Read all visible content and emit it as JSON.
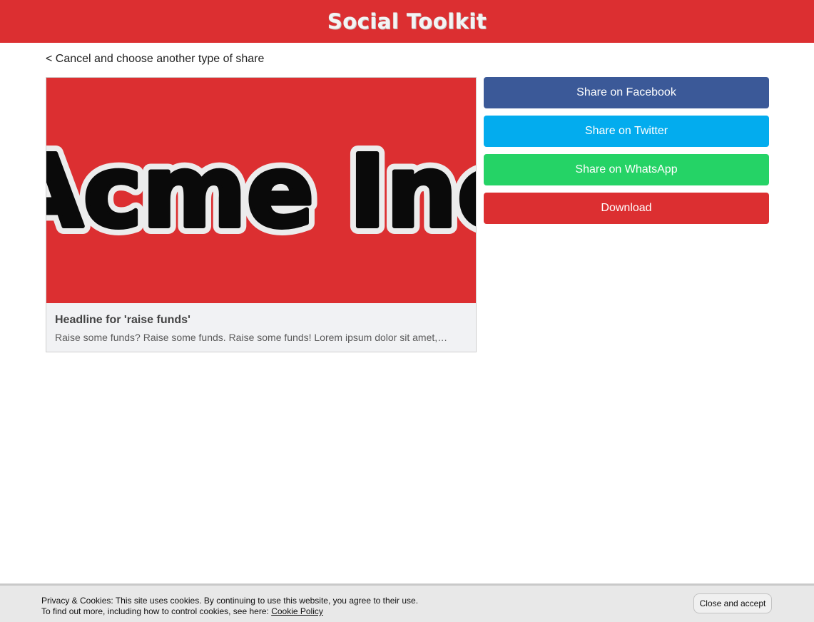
{
  "header": {
    "title": "Social Toolkit",
    "color": "#dc2f31"
  },
  "nav": {
    "back_label": "< Cancel and choose another type of share"
  },
  "preview": {
    "image_logo_text": "Acme Inc",
    "headline": "Headline for 'raise funds'",
    "description": "Raise some funds? Raise some funds. Raise some funds! Lorem ipsum dolor sit amet, consectetur adipiscing elit."
  },
  "share_buttons": [
    {
      "label": "Share on Facebook",
      "color": "#3b5998"
    },
    {
      "label": "Share on Twitter",
      "color": "#03acee"
    },
    {
      "label": "Share on WhatsApp",
      "color": "#25d366"
    },
    {
      "label": "Download",
      "color": "#dc2f31"
    }
  ],
  "cookie": {
    "line1": "Privacy & Cookies: This site uses cookies. By continuing to use this website, you agree to their use.",
    "line2_prefix": "To find out more, including how to control cookies, see here: ",
    "policy_link": "Cookie Policy",
    "accept_label": "Close and accept"
  }
}
